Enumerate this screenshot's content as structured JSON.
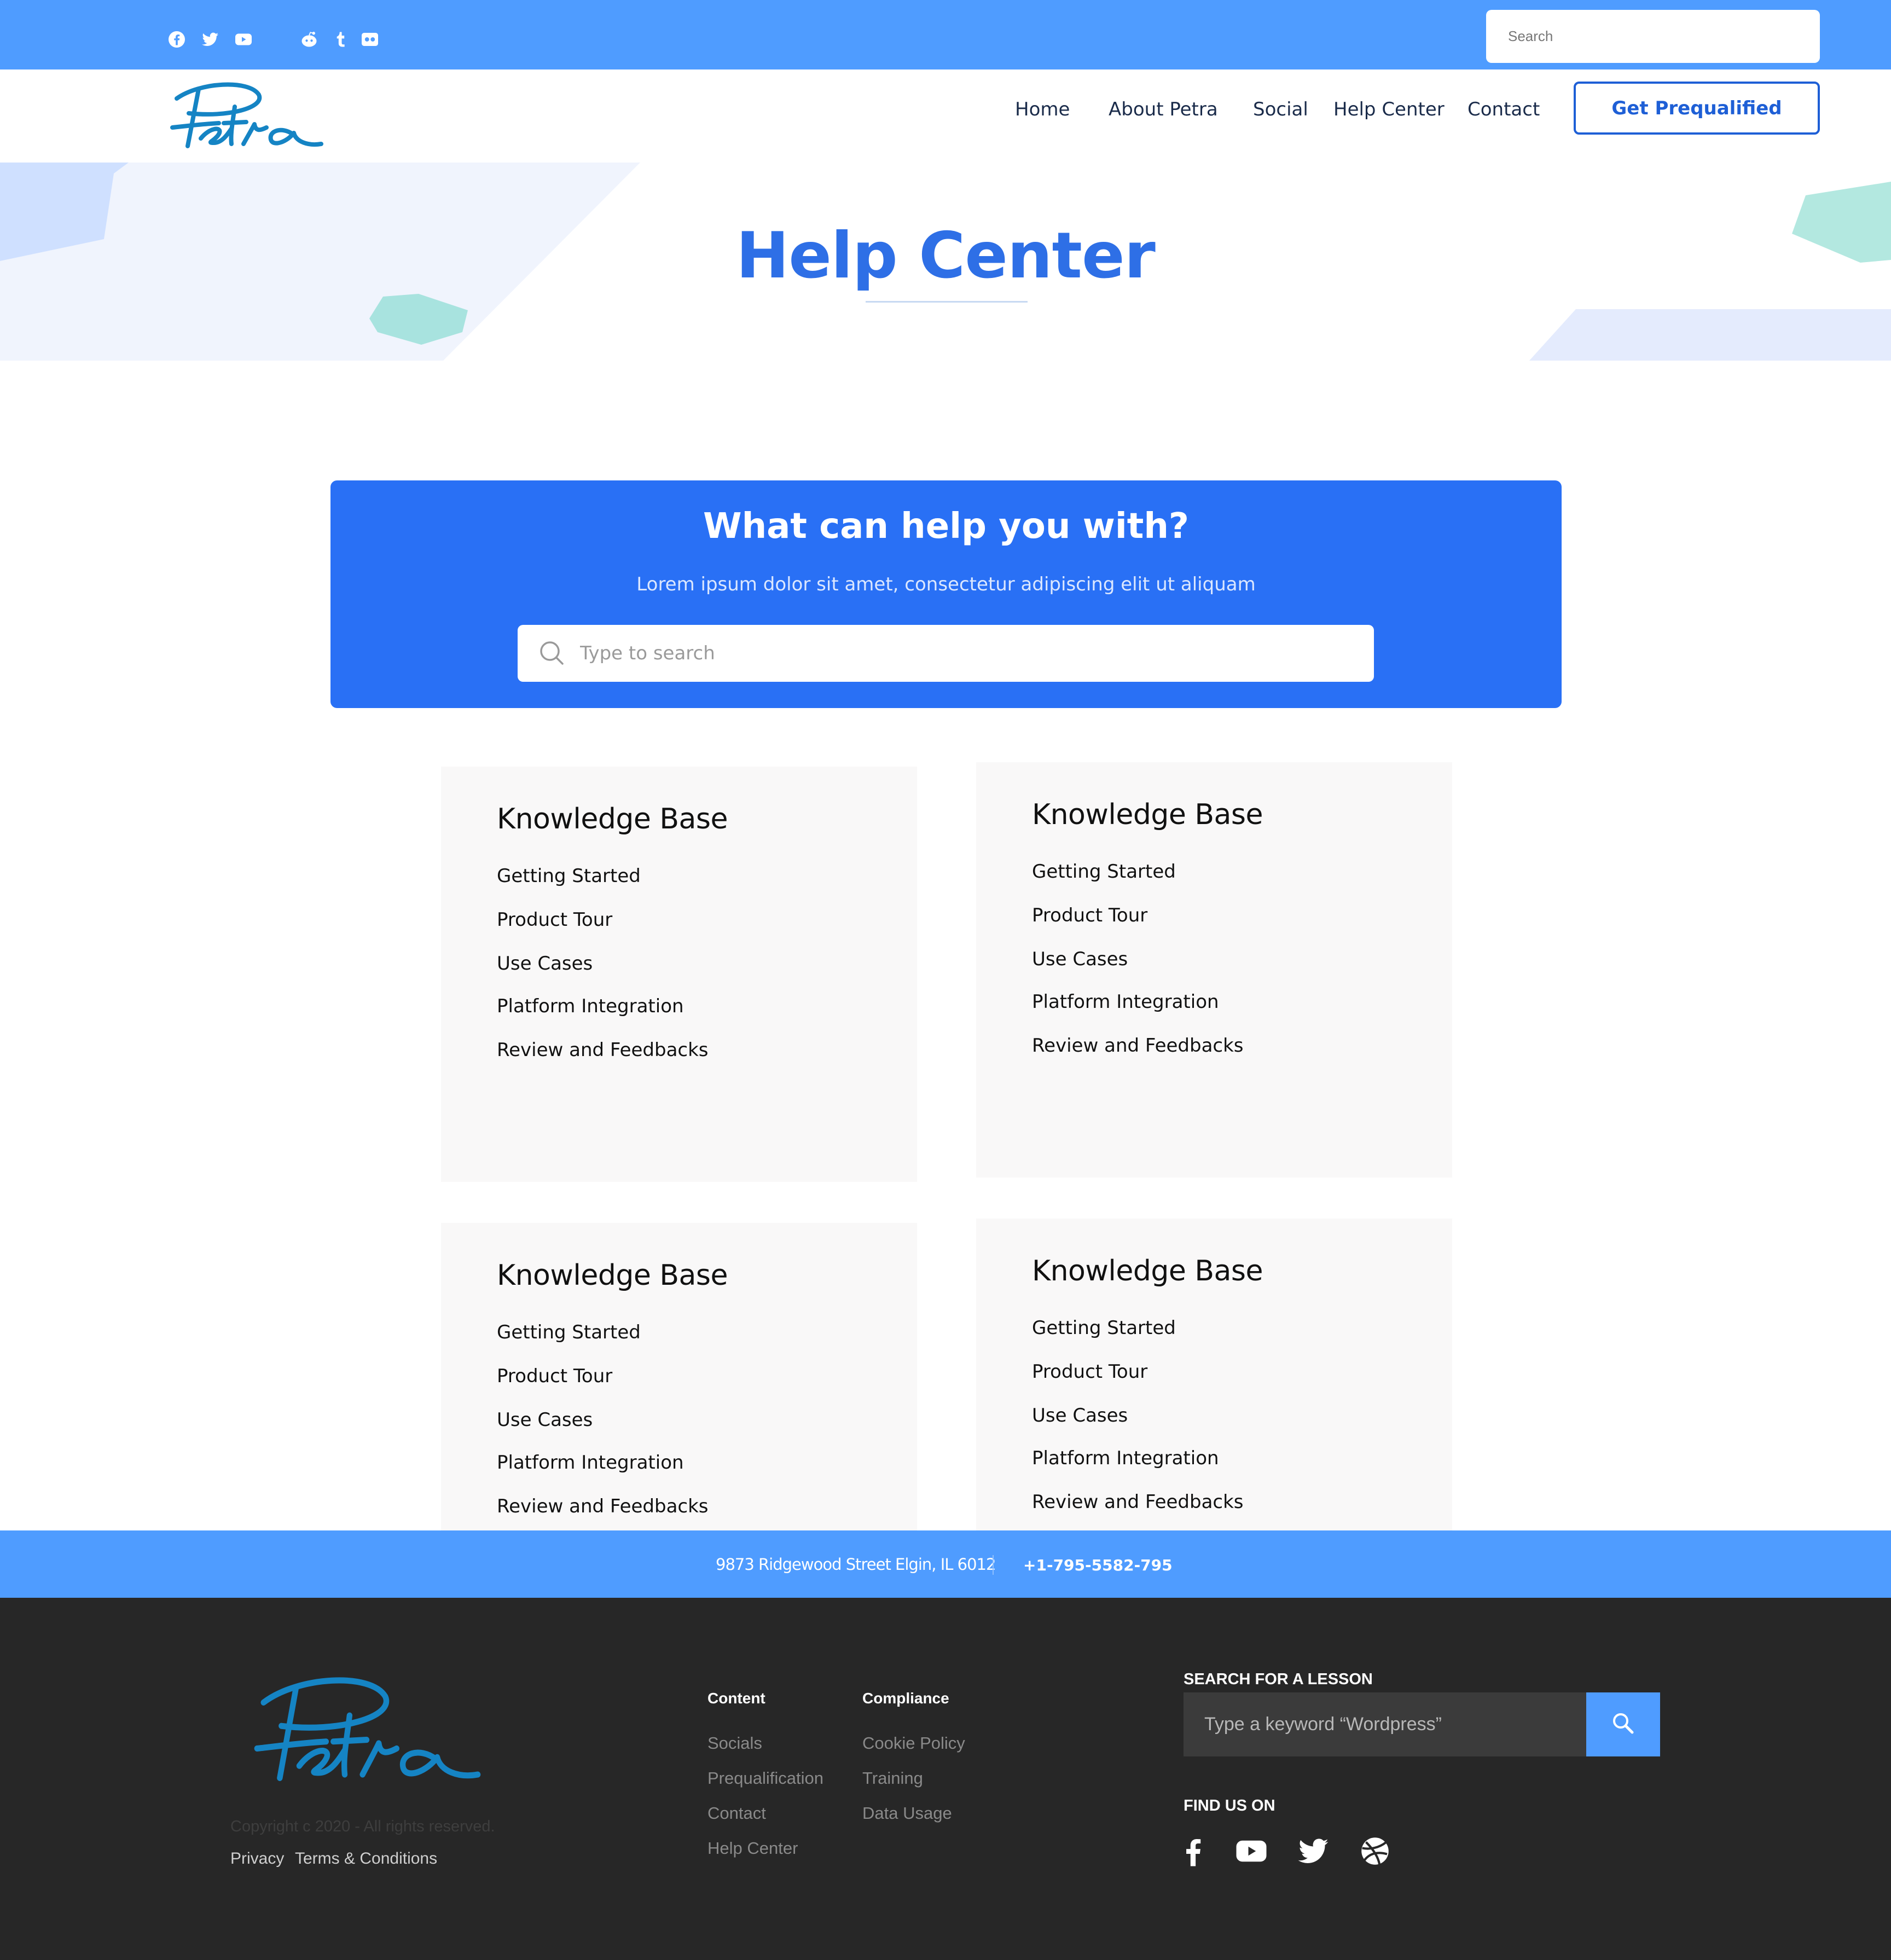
{
  "topbar": {
    "social_icons": [
      "facebook-icon",
      "twitter-icon",
      "youtube-icon",
      "reddit-icon",
      "tumblr-icon",
      "flickr-icon"
    ],
    "search_placeholder": "Search"
  },
  "header": {
    "logo_text": "Petra",
    "nav": [
      "Home",
      "About Petra",
      "Social",
      "Help Center",
      "Contact"
    ],
    "cta_label": "Get Prequalified"
  },
  "hero": {
    "title": "Help Center"
  },
  "help_search": {
    "title": "What can help you with?",
    "subtitle": "Lorem ipsum dolor sit amet, consectetur adipiscing elit ut aliquam",
    "placeholder": "Type to search"
  },
  "cards": [
    {
      "title": "Knowledge Base",
      "links": [
        "Getting Started",
        "Product Tour",
        "Use Cases",
        "Platform Integration",
        "Review and Feedbacks"
      ]
    },
    {
      "title": "Knowledge Base",
      "links": [
        "Getting Started",
        "Product Tour",
        "Use Cases",
        "Platform Integration",
        "Review and Feedbacks"
      ]
    },
    {
      "title": "Knowledge Base",
      "links": [
        "Getting Started",
        "Product Tour",
        "Use Cases",
        "Platform Integration",
        "Review and Feedbacks"
      ]
    },
    {
      "title": "Knowledge Base",
      "links": [
        "Getting Started",
        "Product Tour",
        "Use Cases",
        "Platform Integration",
        "Review and Feedbacks"
      ]
    }
  ],
  "contact_bar": {
    "address": "9873 Ridgewood Street Elgin, IL 6012",
    "phone": "+1-795-5582-795"
  },
  "footer": {
    "logo_text": "Petra",
    "copyright": "Copyright c 2020 - All rights reserved.",
    "privacy": "Privacy",
    "terms": "Terms & Conditions",
    "content_col": {
      "heading": "Content",
      "links": [
        "Socials",
        "Prequalification",
        "Contact",
        "Help Center"
      ]
    },
    "compliance_col": {
      "heading": "Compliance",
      "links": [
        "Cookie Policy",
        "Training",
        "Data Usage"
      ]
    },
    "search_heading": "SEARCH FOR A LESSON",
    "search_placeholder": "Type a keyword “Wordpress”",
    "find_us_heading": "FIND US ON",
    "social_icons": [
      "facebook-icon",
      "youtube-icon",
      "twitter-icon",
      "dribbble-icon"
    ]
  },
  "colors": {
    "topbar": "#4f9cff",
    "accent": "#2970f5",
    "hero_title": "#2e6fe6",
    "logo": "#1584c4",
    "footer_bg": "#272727",
    "card_bg": "#f9f8f8"
  }
}
